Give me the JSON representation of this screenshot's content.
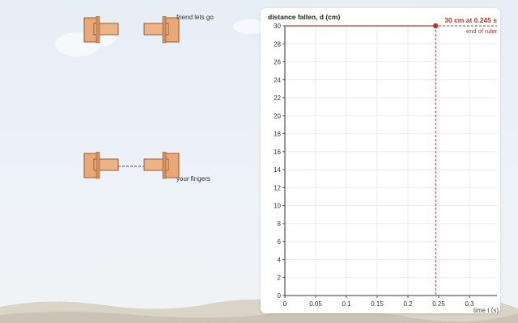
{
  "scene": {
    "label_top": "friend lets go",
    "label_bottom": "your fingers"
  },
  "colors": {
    "hand_fill": "#e8a878",
    "hand_stroke": "#9a5a30",
    "marker": "#b23a2e",
    "axis": "#333333",
    "grid": "#ebebeb",
    "card": "#ffffff"
  },
  "chart_data": {
    "type": "line",
    "title": "distance fallen, d (cm)",
    "xlabel": "time t (s)",
    "ylabel": "distance fallen, d (cm)",
    "xlim": [
      0,
      0.35
    ],
    "ylim": [
      0,
      30
    ],
    "x_ticks": [
      "0",
      "0.05",
      "0.1",
      "0.15",
      "0.2",
      "0.25",
      "0.3"
    ],
    "y_ticks": [
      "0",
      "2",
      "4",
      "6",
      "8",
      "10",
      "12",
      "14",
      "16",
      "18",
      "20",
      "22",
      "24",
      "26",
      "28",
      "30"
    ],
    "grid": true,
    "reference_point": {
      "x": 0.245,
      "y": 30
    },
    "annotations": {
      "point_label": "30 cm at 0.245 s",
      "end_label": "end of ruler"
    }
  }
}
